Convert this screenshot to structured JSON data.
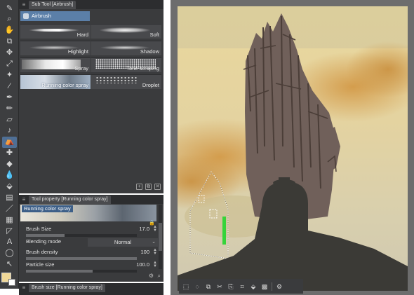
{
  "toolbar": {
    "tools": [
      {
        "name": "brush-icon",
        "glyph": "✎"
      },
      {
        "name": "zoom-icon",
        "glyph": "⌕"
      },
      {
        "name": "hand-icon",
        "glyph": "✋"
      },
      {
        "name": "layer-select-icon",
        "glyph": "⧉"
      },
      {
        "name": "move-icon",
        "glyph": "✥"
      },
      {
        "name": "operation-icon",
        "glyph": "⤢"
      },
      {
        "name": "magic-wand-icon",
        "glyph": "✦"
      },
      {
        "name": "eyedropper-icon",
        "glyph": "⁄"
      },
      {
        "name": "pen-icon",
        "glyph": "✒"
      },
      {
        "name": "pencil-icon",
        "glyph": "✏"
      },
      {
        "name": "marker-icon",
        "glyph": "▱"
      },
      {
        "name": "brush-tool-icon",
        "glyph": "♪"
      },
      {
        "name": "airbrush-icon",
        "glyph": "⛺",
        "active": true
      },
      {
        "name": "decoration-icon",
        "glyph": "✚"
      },
      {
        "name": "eraser-icon",
        "glyph": "◆"
      },
      {
        "name": "blend-icon",
        "glyph": "💧"
      },
      {
        "name": "fill-icon",
        "glyph": "⬙"
      },
      {
        "name": "gradient-icon",
        "glyph": "▤"
      },
      {
        "name": "figure-icon",
        "glyph": "／"
      },
      {
        "name": "frame-icon",
        "glyph": "▦"
      },
      {
        "name": "ruler-icon",
        "glyph": "◸"
      },
      {
        "name": "text-icon",
        "glyph": "A"
      },
      {
        "name": "balloon-icon",
        "glyph": "◯"
      },
      {
        "name": "correct-line-icon",
        "glyph": "↖"
      }
    ],
    "main_color": "#f0d898",
    "sub_color": "#ffffff"
  },
  "subtool": {
    "tab_label": "Sub Tool [Airbrush]",
    "group_label": "Airbrush",
    "brushes": [
      {
        "label": "Hard"
      },
      {
        "label": "Soft"
      },
      {
        "label": "Highlight"
      },
      {
        "label": "Shadow"
      },
      {
        "label": "Spray"
      },
      {
        "label": "Tone scraping"
      },
      {
        "label": "Running color spray"
      },
      {
        "label": "Droplet"
      }
    ]
  },
  "toolprop": {
    "tab_label": "Tool property [Running color spray]",
    "preview_label": "Running color spray",
    "brush_size": {
      "name": "Brush Size",
      "value": "17.0",
      "fraction": 0.35
    },
    "blending": {
      "name": "Blending mode",
      "value": "Normal"
    },
    "density": {
      "name": "Brush density",
      "value": "100",
      "fraction": 1.0
    },
    "particle": {
      "name": "Particle size",
      "value": "100.0",
      "fraction": 0.6
    }
  },
  "next_panel": {
    "tab_label": "Brush size [Running color spray]"
  },
  "canvas": {
    "toolbar_icons": [
      "select-all-icon",
      "lasso-icon",
      "copy-icon",
      "cut-icon",
      "paste-icon",
      "crop-icon",
      "fill-selection-icon",
      "tone-icon",
      "settings-icon"
    ]
  },
  "colors": {
    "panel_bg": "#3a3b3d",
    "accent": "#5b7fa8",
    "sky_yellow": "#f0dfa6",
    "smoke_orange": "#d4a15a",
    "tower_brown": "#6f5f55",
    "ground_dark": "#3b3a36",
    "highlight_green": "#35d43a"
  }
}
